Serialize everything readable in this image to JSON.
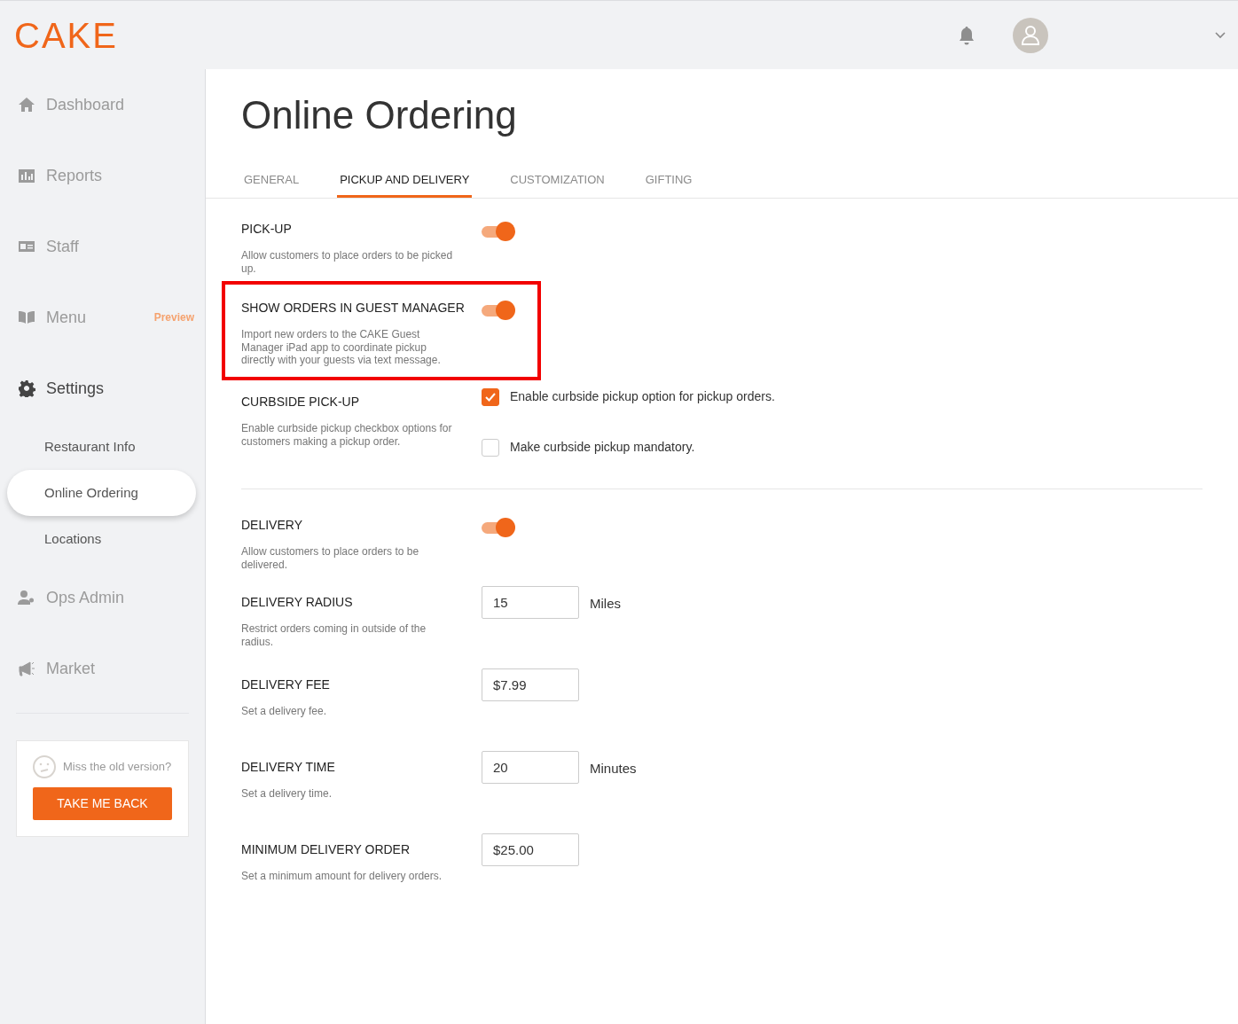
{
  "brand": "CAKE",
  "topbar": {
    "has_notifications": true,
    "has_avatar": true
  },
  "sidebar": {
    "items": [
      {
        "label": "Dashboard",
        "selected": false
      },
      {
        "label": "Reports",
        "selected": false
      },
      {
        "label": "Staff",
        "selected": false
      },
      {
        "label": "Menu",
        "selected": false,
        "badge": "Preview"
      },
      {
        "label": "Settings",
        "selected": true,
        "children": [
          {
            "label": "Restaurant Info",
            "selected": false
          },
          {
            "label": "Online Ordering",
            "selected": true
          },
          {
            "label": "Locations",
            "selected": false
          }
        ]
      },
      {
        "label": "Ops Admin",
        "selected": false
      },
      {
        "label": "Market",
        "selected": false
      }
    ],
    "old_version": {
      "text": "Miss the old version?",
      "button": "TAKE ME BACK"
    }
  },
  "page": {
    "title": "Online Ordering",
    "tabs": [
      {
        "label": "GENERAL",
        "selected": false
      },
      {
        "label": "PICKUP AND DELIVERY",
        "selected": true
      },
      {
        "label": "CUSTOMIZATION",
        "selected": false
      },
      {
        "label": "GIFTING",
        "selected": false
      }
    ],
    "settings": [
      {
        "kind": "toggle",
        "title": "PICK-UP",
        "description": "Allow customers to place orders to be picked up.",
        "on": true,
        "highlighted": false
      },
      {
        "kind": "toggle",
        "title": "SHOW ORDERS IN GUEST MANAGER",
        "description": "Import new orders to the CAKE Guest Manager iPad app to coordinate pickup directly with your guests via text message.",
        "on": true,
        "highlighted": true
      },
      {
        "kind": "checks",
        "title": "CURBSIDE PICK-UP",
        "description": "Enable curbside pickup checkbox options for customers making a pickup order.",
        "highlighted": false,
        "options": [
          {
            "label": "Enable curbside pickup option for pickup orders.",
            "checked": true
          },
          {
            "label": "Make curbside pickup mandatory.",
            "checked": false
          }
        ]
      },
      {
        "kind": "divider"
      },
      {
        "kind": "toggle",
        "title": "DELIVERY",
        "description": "Allow customers to place orders to be delivered.",
        "on": true,
        "highlighted": false
      },
      {
        "kind": "field",
        "title": "DELIVERY RADIUS",
        "description": "Restrict orders coming in outside of the radius.",
        "value": "15",
        "unit": "Miles",
        "highlighted": false
      },
      {
        "kind": "field",
        "title": "DELIVERY FEE",
        "description": "Set a delivery fee.",
        "value": "$7.99",
        "highlighted": false
      },
      {
        "kind": "field",
        "title": "DELIVERY TIME",
        "description": "Set a delivery time.",
        "value": "20",
        "unit": "Minutes",
        "highlighted": false
      },
      {
        "kind": "field",
        "title": "MINIMUM DELIVERY ORDER",
        "description": "Set a minimum amount for delivery orders.",
        "value": "$25.00",
        "highlighted": false
      }
    ]
  }
}
